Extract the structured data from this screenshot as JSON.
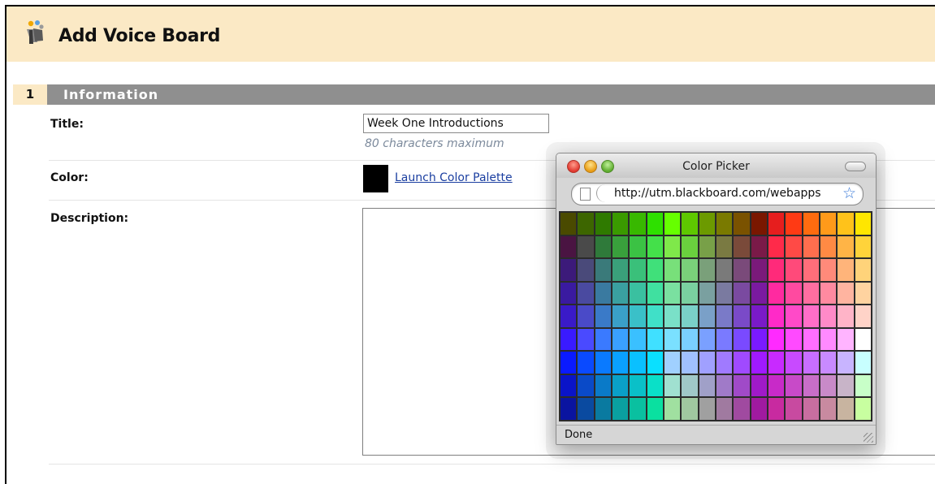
{
  "header": {
    "title": "Add Voice Board",
    "icon": "voice-board-icon"
  },
  "section": {
    "number": "1",
    "label": "Information"
  },
  "form": {
    "title_label": "Title:",
    "title_value": "Week One Introductions",
    "title_hint": "80 characters maximum",
    "color_label": "Color:",
    "color_value": "#000000",
    "palette_link": "Launch Color Palette",
    "description_label": "Description:"
  },
  "popup": {
    "window_title": "Color Picker",
    "url": "http://utm.blackboard.com/webapps",
    "status": "Done",
    "palette_rows": [
      [
        "#4a4a00",
        "#3d6600",
        "#2f7a00",
        "#3a9a00",
        "#38b800",
        "#2ee000",
        "#66ff00",
        "#5ec800",
        "#6c9a00",
        "#7a7a00",
        "#7a5200",
        "#7a1700",
        "#e61e1e",
        "#ff3a14",
        "#ff6b0f",
        "#ff9a1a",
        "#ffc21a",
        "#ffe600"
      ],
      [
        "#4a1442",
        "#4a4a4a",
        "#2f7a3a",
        "#39a03c",
        "#3bc244",
        "#44e04a",
        "#7fe84a",
        "#6ad03e",
        "#78a048",
        "#7a7a42",
        "#7a4a3a",
        "#7a1a48",
        "#ff2a4a",
        "#ff4a46",
        "#ff6e4e",
        "#ff8a44",
        "#ffb446",
        "#ffd33a"
      ],
      [
        "#3c1a7a",
        "#4a4a7a",
        "#3a7a7a",
        "#3aa07a",
        "#3ac07a",
        "#40e07a",
        "#78e07a",
        "#7ad07a",
        "#7aa07a",
        "#7a7a7a",
        "#7a4a7a",
        "#7a1a7a",
        "#ff2a7a",
        "#ff4a7a",
        "#ff6e7a",
        "#ff8a7a",
        "#ffb47a",
        "#ffd37a"
      ],
      [
        "#3a1aa0",
        "#4a4aa0",
        "#3a7aa0",
        "#3aa0a0",
        "#3ac0a0",
        "#40e0a0",
        "#7ae0a0",
        "#7ad0a0",
        "#7aa0a0",
        "#7a7aa0",
        "#7a4aa0",
        "#7a1aa0",
        "#ff2aa0",
        "#ff4aa0",
        "#ff6ea0",
        "#ff8aa0",
        "#ffb4a0",
        "#ffd3a0"
      ],
      [
        "#3a1ac8",
        "#4a4ac8",
        "#3a7ac8",
        "#3aa0c8",
        "#3ac0c8",
        "#40e0c8",
        "#7ae0c8",
        "#7ad0c8",
        "#7aa0c8",
        "#7a7ac8",
        "#7a4ac8",
        "#7a1ac8",
        "#ff2ac8",
        "#ff4ac8",
        "#ff6ec8",
        "#ff8ac8",
        "#ffb4c8",
        "#ffd3c8"
      ],
      [
        "#3a1aff",
        "#4a4aff",
        "#3a7aff",
        "#3aa0ff",
        "#3ac0ff",
        "#40e0ff",
        "#7ae0ff",
        "#7ad0ff",
        "#7aa0ff",
        "#7a7aff",
        "#7a4aff",
        "#7a1aff",
        "#ff2aff",
        "#ff4aff",
        "#ff6eff",
        "#ff8aff",
        "#ffb4ff",
        "#ffffff"
      ],
      [
        "#0a1aff",
        "#0a4aff",
        "#0a7aff",
        "#0aa0ff",
        "#0ac0ff",
        "#0ae0ff",
        "#a0d0ff",
        "#a0c0ff",
        "#a0a0ff",
        "#a07aff",
        "#a04aff",
        "#a01aff",
        "#c82aff",
        "#c84aff",
        "#c86eff",
        "#c88aff",
        "#c8b4ff",
        "#c8ffff"
      ],
      [
        "#0a14c8",
        "#0a4ac8",
        "#0a7ac8",
        "#0aa0c8",
        "#0ac0c8",
        "#0ae0c8",
        "#a0e0d0",
        "#a0c8c8",
        "#a0a0c8",
        "#a07ac8",
        "#a04ac8",
        "#a01ac8",
        "#c82ac8",
        "#c84ac8",
        "#c86ec8",
        "#c88ac8",
        "#c8b4c8",
        "#c8ffc8"
      ],
      [
        "#0a14a0",
        "#0a4aa0",
        "#0a7aa0",
        "#0aa0a0",
        "#0ac0a0",
        "#0ae0a0",
        "#a0e0a0",
        "#a0c8a0",
        "#a0a0a0",
        "#a07aa0",
        "#a04aa0",
        "#a01aa0",
        "#c82aa0",
        "#c84aa0",
        "#c86ea0",
        "#c88aa0",
        "#c8b4a0",
        "#c8ffa0"
      ]
    ]
  }
}
